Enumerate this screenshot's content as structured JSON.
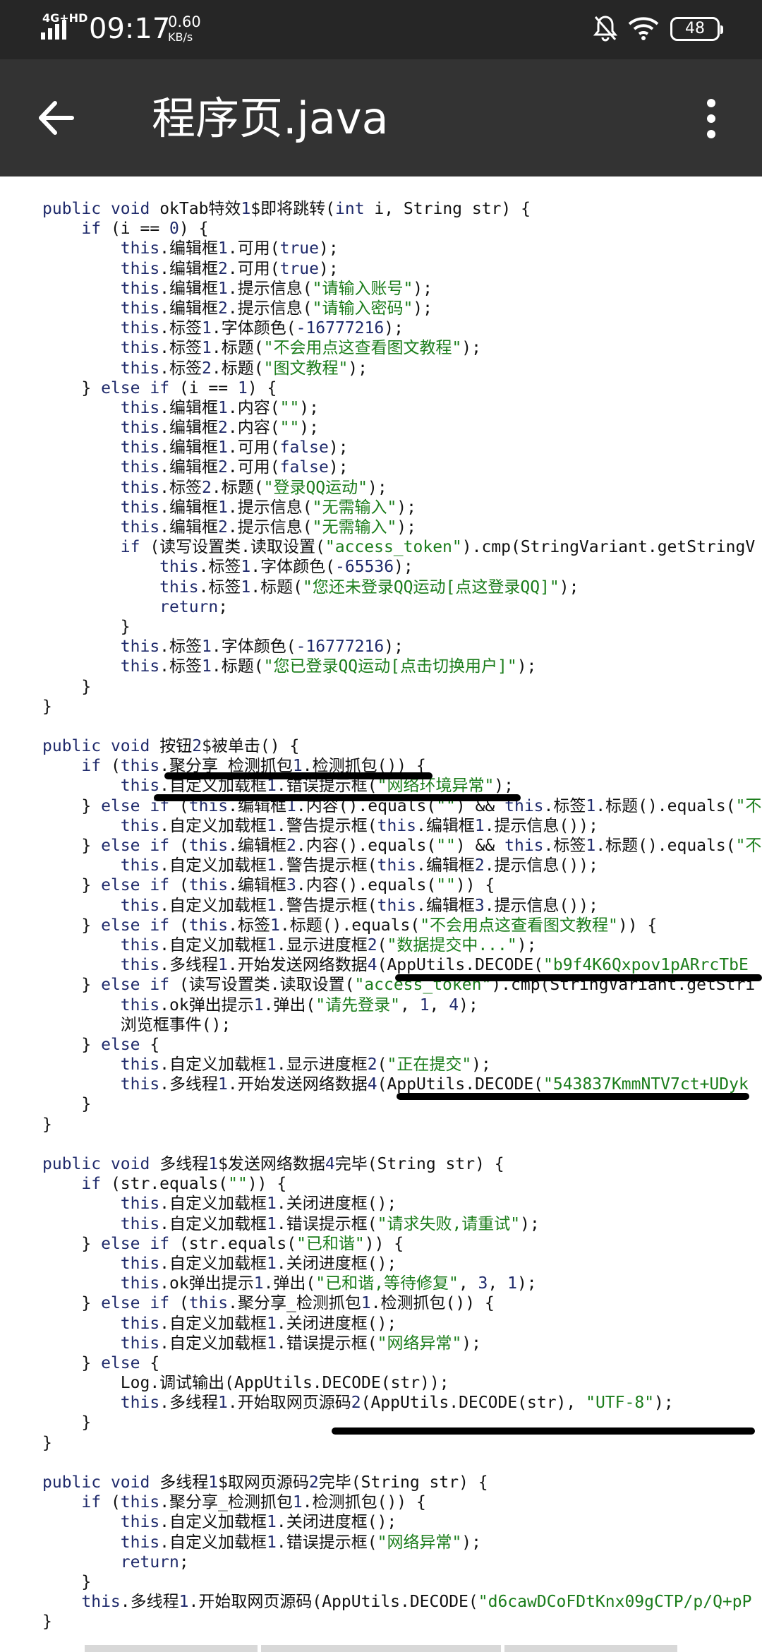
{
  "status_bar": {
    "network": "4G+HD",
    "time": "09:17",
    "speed_value": "0.60",
    "speed_unit": "KB/s",
    "battery": "48"
  },
  "app_bar": {
    "back_icon": "arrow-left-icon",
    "title": "程序页.java",
    "more_icon": "more-vert-icon"
  },
  "code_lines": [
    "public void okTab特效1$即将跳转(int i, String str) {",
    "    if (i == 0) {",
    "        this.编辑框1.可用(true);",
    "        this.编辑框2.可用(true);",
    "        this.编辑框1.提示信息(\"请输入账号\");",
    "        this.编辑框2.提示信息(\"请输入密码\");",
    "        this.标签1.字体颜色(-16777216);",
    "        this.标签1.标题(\"不会用点这查看图文教程\");",
    "        this.标签2.标题(\"图文教程\");",
    "    } else if (i == 1) {",
    "        this.编辑框1.内容(\"\");",
    "        this.编辑框2.内容(\"\");",
    "        this.编辑框1.可用(false);",
    "        this.编辑框2.可用(false);",
    "        this.标签2.标题(\"登录QQ运动\");",
    "        this.编辑框1.提示信息(\"无需输入\");",
    "        this.编辑框2.提示信息(\"无需输入\");",
    "        if (读写设置类.读取设置(\"access_token\").cmp(StringVariant.getStringV",
    "            this.标签1.字体颜色(-65536);",
    "            this.标签1.标题(\"您还未登录QQ运动[点这登录QQ]\");",
    "            return;",
    "        }",
    "        this.标签1.字体颜色(-16777216);",
    "        this.标签1.标题(\"您已登录QQ运动[点击切换用户]\");",
    "    }",
    "}",
    "",
    "public void 按钮2$被单击() {",
    "    if (this.聚分享_检测抓包1.检测抓包()) {",
    "        this.自定义加载框1.错误提示框(\"网络环境异常\");",
    "    } else if (this.编辑框1.内容().equals(\"\") && this.标签1.标题().equals(\"不",
    "        this.自定义加载框1.警告提示框(this.编辑框1.提示信息());",
    "    } else if (this.编辑框2.内容().equals(\"\") && this.标签1.标题().equals(\"不",
    "        this.自定义加载框1.警告提示框(this.编辑框2.提示信息());",
    "    } else if (this.编辑框3.内容().equals(\"\")) {",
    "        this.自定义加载框1.警告提示框(this.编辑框3.提示信息());",
    "    } else if (this.标签1.标题().equals(\"不会用点这查看图文教程\")) {",
    "        this.自定义加载框1.显示进度框2(\"数据提交中...\");",
    "        this.多线程1.开始发送网络数据4(AppUtils.DECODE(\"b9f4K6Qxpov1pARrcTbE",
    "    } else if (读写设置类.读取设置(\"access_token\").cmp(StringVariant.getStri",
    "        this.ok弹出提示1.弹出(\"请先登录\", 1, 4);",
    "        浏览框事件();",
    "    } else {",
    "        this.自定义加载框1.显示进度框2(\"正在提交\");",
    "        this.多线程1.开始发送网络数据4(AppUtils.DECODE(\"543837KmmNTV7ct+UDyk",
    "    }",
    "}",
    "",
    "public void 多线程1$发送网络数据4完毕(String str) {",
    "    if (str.equals(\"\")) {",
    "        this.自定义加载框1.关闭进度框();",
    "        this.自定义加载框1.错误提示框(\"请求失败,请重试\");",
    "    } else if (str.equals(\"已和谐\")) {",
    "        this.自定义加载框1.关闭进度框();",
    "        this.ok弹出提示1.弹出(\"已和谐,等待修复\", 3, 1);",
    "    } else if (this.聚分享_检测抓包1.检测抓包()) {",
    "        this.自定义加载框1.关闭进度框();",
    "        this.自定义加载框1.错误提示框(\"网络异常\");",
    "    } else {",
    "        Log.调试输出(AppUtils.DECODE(str));",
    "        this.多线程1.开始取网页源码2(AppUtils.DECODE(str), \"UTF-8\");",
    "    }",
    "}",
    "",
    "public void 多线程1$取网页源码2完毕(String str) {",
    "    if (this.聚分享_检测抓包1.检测抓包()) {",
    "        this.自定义加载框1.关闭进度框();",
    "        this.自定义加载框1.错误提示框(\"网络异常\");",
    "        return;",
    "    }",
    "    this.多线程1.开始取网页源码(AppUtils.DECODE(\"d6cawDCoFDtKnx09gCTP/p/Q+pP",
    "}"
  ]
}
